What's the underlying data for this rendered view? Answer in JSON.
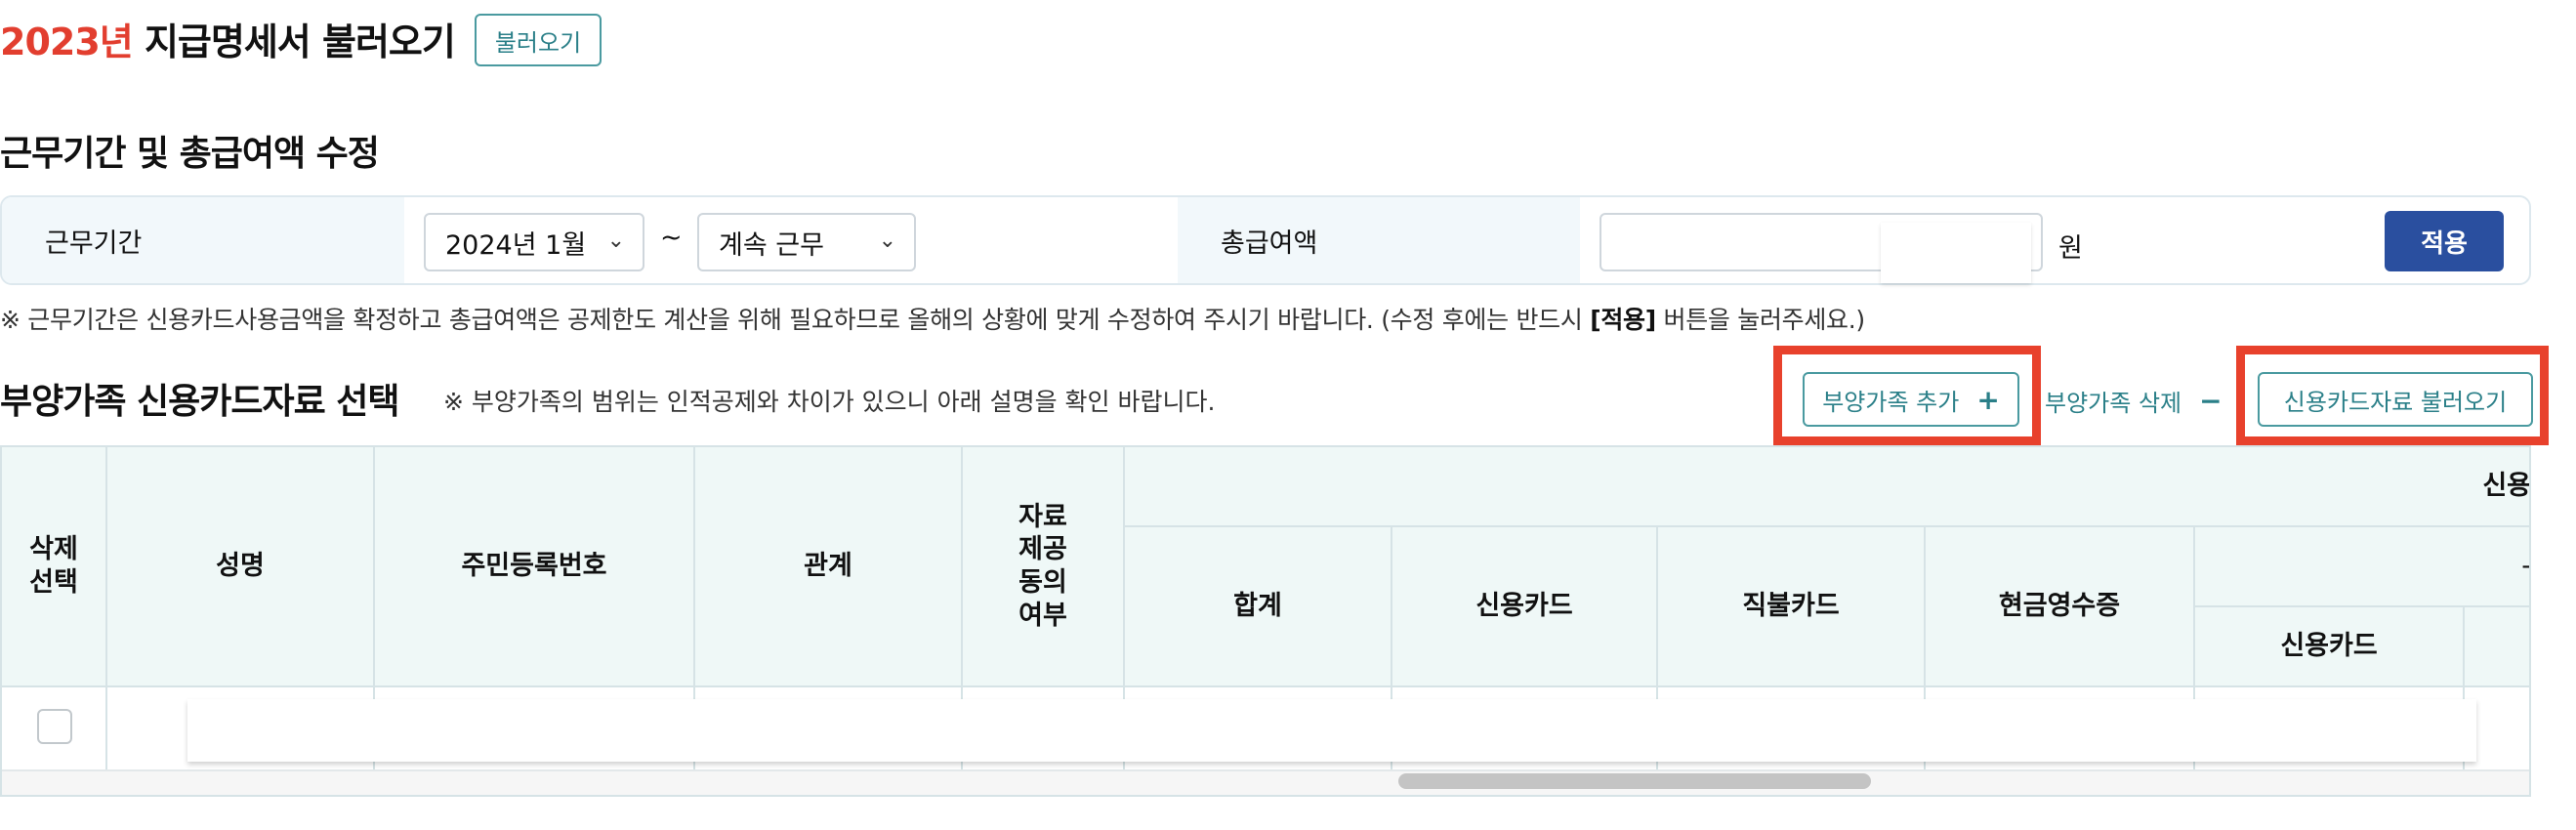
{
  "header": {
    "year": "2023년",
    "title": " 지급명세서 불러오기",
    "load_button": "불러오기"
  },
  "period_section": {
    "title": "근무기간 및 총급여액 수정",
    "period_label": "근무기간",
    "start_month": "2024년 1월",
    "tilde": "~",
    "end_period": "계속 근무",
    "amount_label": "총급여액",
    "amount_value": "",
    "unit": "원",
    "apply_button": "적용"
  },
  "notice": {
    "before": "※ 근무기간은 신용카드사용금액을 확정하고 총급여액은 공제한도 계산을 위해 필요하므로 올해의 상황에 맞게 수정하여 주시기 바랍니다. (수정 후에는 반드시 ",
    "bold": "[적용]",
    "after": " 버튼을 눌러주세요.)"
  },
  "dependents_section": {
    "title": "부양가족 신용카드자료 선택",
    "note": "※ 부양가족의 범위는 인적공제와 차이가 있으니 아래 설명을 확인 바랍니다.",
    "add_button": "부양가족 추가",
    "add_symbol": "+",
    "delete_button": "부양가족 삭제",
    "delete_symbol": "−",
    "load_card_button": "신용카드자료 불러오기"
  },
  "table": {
    "col_delete": "삭제\n선택",
    "col_name": "성명",
    "col_rrn": "주민등록번호",
    "col_relation": "관계",
    "col_consent": "자료\n제공\n동의\n여부",
    "col_group_top": "신용",
    "col_total": "합계",
    "col_credit": "신용카드",
    "col_debit": "직불카드",
    "col_cash": "현금영수증",
    "col_group_sub": "-",
    "col_sub_credit": "신용카드"
  },
  "colors": {
    "accent_red": "#e23e2f",
    "teal": "#2a7f88",
    "apply_blue": "#2a4f9f",
    "header_bg": "#eff8f7"
  }
}
